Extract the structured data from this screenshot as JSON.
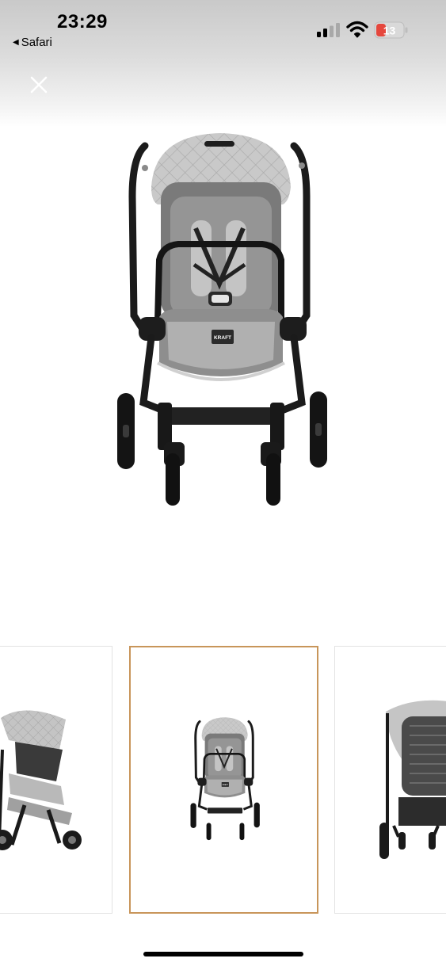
{
  "status_bar": {
    "time": "23:29",
    "back_app_label": "Safari",
    "battery_level": "13",
    "battery_color": "#e5473d",
    "icons": [
      "cellular-signal-icon",
      "wifi-icon",
      "battery-icon"
    ]
  },
  "viewer": {
    "close_icon": "close-icon",
    "hero_image": "stroller-front-view",
    "hero_brand_tag": "KRAFT",
    "accent_color": "#c8955a"
  },
  "gallery": {
    "selected_index": 1,
    "thumbnails": [
      {
        "image": "stroller-side-angle-view"
      },
      {
        "image": "stroller-front-view",
        "brand_tag": "KRAFT"
      },
      {
        "image": "stroller-back-view"
      }
    ]
  }
}
